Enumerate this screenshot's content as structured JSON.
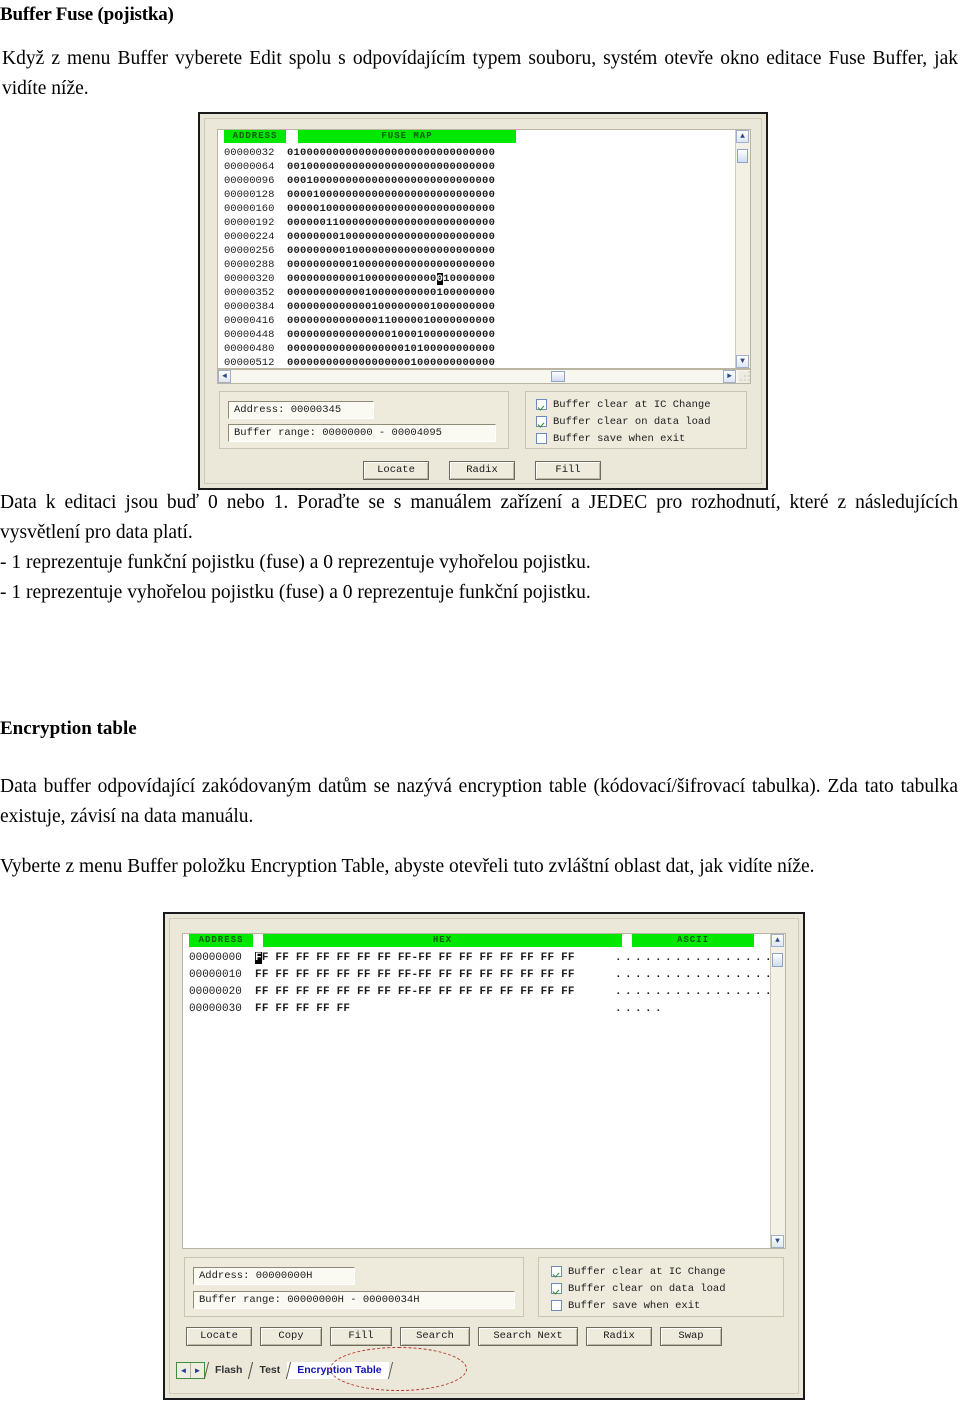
{
  "document": {
    "heading1": "Buffer Fuse (pojistka)",
    "intro": "Když z menu Buffer vyberete Edit spolu s odpovídajícím typem souboru, systém otevře okno editace Fuse Buffer, jak vidíte níže.",
    "data_paragraph": "Data k editaci jsou buď 0 nebo 1. Poraďte se s manuálem zařízení a JEDEC  pro rozhodnutí, které z následujících vysvětlení pro data platí.",
    "bullet1": "- 1 reprezentuje funkční pojistku (fuse) a 0 reprezentuje vyhořelou pojistku.",
    "bullet2": "- 1 reprezentuje vyhořelou pojistku (fuse) a 0 reprezentuje funkční pojistku.",
    "heading2": "Encryption table",
    "encryption_paragraph1": "Data buffer odpovídající zakódovaným datům se nazývá encryption table (kódovací/šifrovací tabulka). Zda tato tabulka existuje, závisí na data manuálu.",
    "encryption_paragraph2": "Vyberte z menu Buffer položku Encryption Table, abyste otevřeli tuto zvláštní oblast dat, jak vidíte níže."
  },
  "colors": {
    "header_green": "#00e800",
    "header_text_green": "#0a5a0a",
    "window_bg": "#e9e6d8",
    "grid_bg": "#ffffff",
    "tab_selected_text": "#1414b4",
    "annotation_red": "#b5342b"
  },
  "fuse_window": {
    "columns": {
      "address": "ADDRESS",
      "fuse_map": "FUSE MAP"
    },
    "rows": [
      {
        "address": "00000032",
        "bits": "01000000000000000000000000000000"
      },
      {
        "address": "00000064",
        "bits": "00100000000000000000000000000000"
      },
      {
        "address": "00000096",
        "bits": "00010000000000000000000000000000"
      },
      {
        "address": "00000128",
        "bits": "00001000000000000000000000000000"
      },
      {
        "address": "00000160",
        "bits": "00000100000000000000000000000000"
      },
      {
        "address": "00000192",
        "bits": "00000011000000000000000000000000"
      },
      {
        "address": "00000224",
        "bits": "00000000100000000000000000000000"
      },
      {
        "address": "00000256",
        "bits": "00000000010000000000000000000000"
      },
      {
        "address": "00000288",
        "bits": "00000000001000000000000000000000"
      },
      {
        "address": "00000320",
        "bits": "00000000000100000000000010000000"
      },
      {
        "address": "00000352",
        "bits": "00000000000010000000000100000000"
      },
      {
        "address": "00000384",
        "bits": "00000000000001000000001000000000"
      },
      {
        "address": "00000416",
        "bits": "00000000000000110000010000000000"
      },
      {
        "address": "00000448",
        "bits": "00000000000000001000100000000000"
      },
      {
        "address": "00000480",
        "bits": "00000000000000000010100000000000"
      },
      {
        "address": "00000512",
        "bits": "00000000000000000001000000000000"
      }
    ],
    "cursor_row_index": 9,
    "cursor_col_index": 23,
    "status": {
      "address_label": "Address: 00000345",
      "buffer_range_label": "Buffer range: 00000000 - 00004095"
    },
    "options": [
      {
        "label": "Buffer clear at IC Change",
        "checked": true
      },
      {
        "label": "Buffer clear on data load",
        "checked": true
      },
      {
        "label": "Buffer save when exit",
        "checked": false
      }
    ],
    "buttons": [
      "Locate",
      "Radix",
      "Fill"
    ],
    "scroll": {
      "up": "▲",
      "down": "▼",
      "left": "◄",
      "right": "►"
    }
  },
  "encryption_window": {
    "columns": {
      "address": "ADDRESS",
      "hex": "HEX",
      "ascii": "ASCII"
    },
    "rows": [
      {
        "address": "00000000",
        "hex": "FF FF FF FF FF FF FF FF-FF FF FF FF FF FF FF FF",
        "ascii": "................"
      },
      {
        "address": "00000010",
        "hex": "FF FF FF FF FF FF FF FF-FF FF FF FF FF FF FF FF",
        "ascii": "................"
      },
      {
        "address": "00000020",
        "hex": "FF FF FF FF FF FF FF FF-FF FF FF FF FF FF FF FF",
        "ascii": "................"
      },
      {
        "address": "00000030",
        "hex": "FF FF FF FF FF",
        "ascii": "....."
      }
    ],
    "cursor_row_index": 0,
    "status": {
      "address_label": "Address: 00000000H",
      "buffer_range_label": "Buffer range: 00000000H - 00000034H"
    },
    "options": [
      {
        "label": "Buffer clear at IC Change",
        "checked": true
      },
      {
        "label": "Buffer clear on data load",
        "checked": true
      },
      {
        "label": "Buffer save when exit",
        "checked": false
      }
    ],
    "buttons": [
      "Locate",
      "Copy",
      "Fill",
      "Search",
      "Search Next",
      "Radix",
      "Swap"
    ],
    "tabs": {
      "nav_prev": "◄",
      "nav_next": "►",
      "items": [
        {
          "label": "Flash",
          "selected": false
        },
        {
          "label": "Test",
          "selected": false
        },
        {
          "label": "Encryption Table",
          "selected": true
        }
      ]
    },
    "scroll": {
      "up": "▲",
      "down": "▼"
    }
  }
}
